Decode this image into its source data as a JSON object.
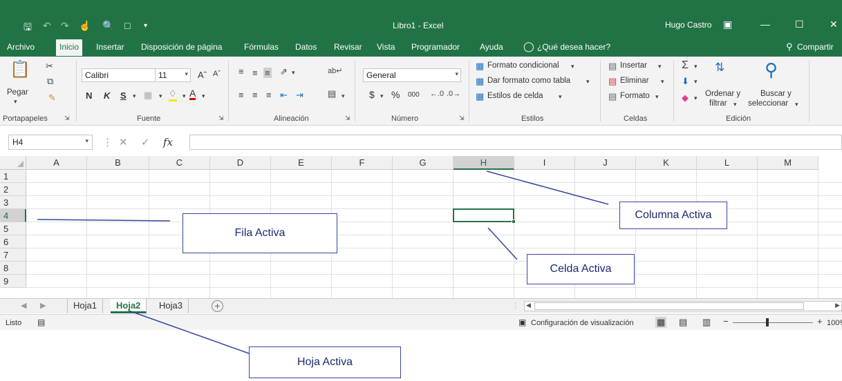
{
  "window": {
    "doc_title": "Libro1  -  Excel",
    "user": "Hugo Castro",
    "quick_access": [
      "save-icon",
      "undo-icon",
      "redo-icon",
      "touch-mode-icon",
      "print-preview-icon",
      "new-file-icon",
      "customize-icon"
    ],
    "controls": [
      "ribbon-display-icon",
      "minimize-icon",
      "maximize-icon",
      "close-icon"
    ]
  },
  "menu": {
    "tabs": [
      "Archivo",
      "Inicio",
      "Insertar",
      "Disposición de página",
      "Fórmulas",
      "Datos",
      "Revisar",
      "Vista",
      "Programador",
      "Ayuda"
    ],
    "active_tab": "Inicio",
    "tell_me": "¿Qué desea hacer?",
    "share": "Compartir"
  },
  "ribbon": {
    "clipboard": {
      "paste": "Pegar",
      "label": "Portapapeles"
    },
    "font": {
      "name": "Calibri",
      "size": "11",
      "bold": "N",
      "italic": "K",
      "underline": "S",
      "label": "Fuente"
    },
    "alignment": {
      "label": "Alineación"
    },
    "number": {
      "format": "General",
      "currency": "$",
      "percent": "%",
      "thousands": "000",
      "label": "Número"
    },
    "styles": {
      "conditional": "Formato condicional",
      "as_table": "Dar formato como tabla",
      "cell_styles": "Estilos de celda",
      "label": "Estilos"
    },
    "cells": {
      "insert": "Insertar",
      "delete": "Eliminar",
      "format": "Formato",
      "label": "Celdas"
    },
    "editing": {
      "sort_line1": "Ordenar y",
      "sort_line2": "filtrar",
      "find_line1": "Buscar y",
      "find_line2": "seleccionar",
      "label": "Edición"
    }
  },
  "formula_bar": {
    "name_box": "H4",
    "fx": "fx",
    "value": ""
  },
  "grid": {
    "columns": [
      "A",
      "B",
      "C",
      "D",
      "E",
      "F",
      "G",
      "H",
      "I",
      "J",
      "K",
      "L",
      "M"
    ],
    "rows": [
      "1",
      "2",
      "3",
      "4",
      "5",
      "6",
      "7",
      "8",
      "9"
    ],
    "active_column": "H",
    "active_row": "4"
  },
  "sheets": {
    "tabs": [
      "Hoja1",
      "Hoja2",
      "Hoja3"
    ],
    "active": "Hoja2"
  },
  "status": {
    "ready": "Listo",
    "display_settings": "Configuración de visualización",
    "zoom": "100%"
  },
  "annotations": {
    "active_row": "Fila Activa",
    "active_column": "Columna Activa",
    "active_cell": "Celda Activa",
    "active_sheet": "Hoja Activa"
  },
  "colors": {
    "excel_green": "#217346",
    "annotation_blue": "#33469b"
  }
}
